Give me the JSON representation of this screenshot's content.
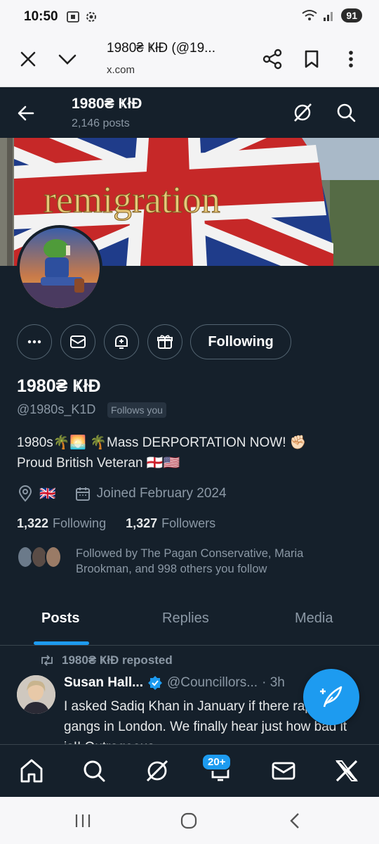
{
  "status_bar": {
    "time": "10:50",
    "battery": "91"
  },
  "browser": {
    "title": "1980₴ ҜłĐ (@19...",
    "url": "x.com"
  },
  "header": {
    "name": "1980₴ ҜłĐ",
    "posts_count": "2,146 posts"
  },
  "banner": {
    "text": "remigration"
  },
  "profile": {
    "name": "1980₴ ҜłĐ",
    "handle": "@1980s_K1D",
    "follows_you": "Follows you",
    "bio_line1": "1980s🌴🌅 🌴Mass DERPORTATION NOW! ✊🏻",
    "bio_line2": "Proud British Veteran 🏴󠁧󠁢󠁥󠁮󠁧󠁿🇺🇸",
    "location": "🇬🇧",
    "joined": "Joined February 2024",
    "following_count": "1,322",
    "following_label": "Following",
    "followers_count": "1,327",
    "followers_label": "Followers",
    "followed_by": "Followed by The Pagan Conservative, Maria Brookman, and 998 others you follow",
    "following_button": "Following"
  },
  "tabs": [
    "Posts",
    "Replies",
    "Media"
  ],
  "post": {
    "repost_label": "1980₴ ҜłĐ reposted",
    "author": "Susan Hall...",
    "handle": "@Councillors...",
    "time": "· 3h",
    "text": "I asked Sadiq Khan in January if there rape gangs in London. We finally hear just how bad it is!! Outrageous"
  },
  "nav": {
    "notif_badge": "20+"
  },
  "colors": {
    "bg": "#15202b",
    "accent": "#1d9bf0",
    "muted": "#8b98a5"
  }
}
